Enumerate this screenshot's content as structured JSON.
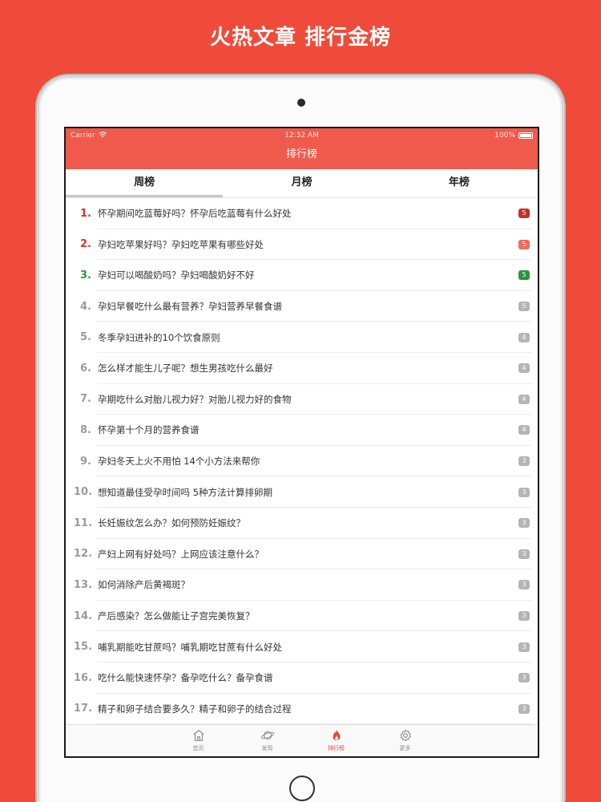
{
  "headline": "火热文章 排行金榜",
  "status": {
    "carrier": "Carrier",
    "time": "12:32 AM",
    "battery": "100%"
  },
  "nav": {
    "title": "排行榜"
  },
  "tabs": [
    {
      "label": "周榜",
      "active": true
    },
    {
      "label": "月榜",
      "active": false
    },
    {
      "label": "年榜",
      "active": false
    }
  ],
  "articles": [
    {
      "rank": "1.",
      "title": "怀孕期间吃蓝莓好吗？怀孕后吃蓝莓有什么好处",
      "count": "5"
    },
    {
      "rank": "2.",
      "title": "孕妇吃苹果好吗？孕妇吃苹果有哪些好处",
      "count": "5"
    },
    {
      "rank": "3.",
      "title": "孕妇可以喝酸奶吗？孕妇喝酸奶好不好",
      "count": "5"
    },
    {
      "rank": "4.",
      "title": "孕妇早餐吃什么最有营养？孕妇营养早餐食谱",
      "count": "5"
    },
    {
      "rank": "5.",
      "title": "冬季孕妇进补的10个饮食原则",
      "count": "4"
    },
    {
      "rank": "6.",
      "title": "怎么样才能生儿子呢？想生男孩吃什么最好",
      "count": "4"
    },
    {
      "rank": "7.",
      "title": "孕期吃什么对胎儿视力好？对胎儿视力好的食物",
      "count": "4"
    },
    {
      "rank": "8.",
      "title": "怀孕第十个月的营养食谱",
      "count": "4"
    },
    {
      "rank": "9.",
      "title": "孕妇冬天上火不用怕 14个小方法来帮你",
      "count": "3"
    },
    {
      "rank": "10.",
      "title": "想知道最佳受孕时间吗 5种方法计算排卵期",
      "count": "3"
    },
    {
      "rank": "11.",
      "title": "长妊娠纹怎么办？如何预防妊娠纹？",
      "count": "3"
    },
    {
      "rank": "12.",
      "title": "产妇上网有好处吗？上网应该注意什么？",
      "count": "3"
    },
    {
      "rank": "13.",
      "title": "如何消除产后黄褐斑？",
      "count": "3"
    },
    {
      "rank": "14.",
      "title": "产后感染？怎么做能让子宫完美恢复？",
      "count": "3"
    },
    {
      "rank": "15.",
      "title": "哺乳期能吃甘蔗吗？哺乳期吃甘蔗有什么好处",
      "count": "3"
    },
    {
      "rank": "16.",
      "title": "吃什么能快速怀孕？备孕吃什么？备孕食谱",
      "count": "3"
    },
    {
      "rank": "17.",
      "title": "精子和卵子结合要多久？精子和卵子的结合过程",
      "count": "3"
    }
  ],
  "tabbar": [
    {
      "label": "首页",
      "icon": "home-icon",
      "active": false
    },
    {
      "label": "发现",
      "icon": "planet-icon",
      "active": false
    },
    {
      "label": "排行榜",
      "icon": "flame-icon",
      "active": true
    },
    {
      "label": "更多",
      "icon": "gear-icon",
      "active": false
    }
  ],
  "colors": {
    "background": "#f04b3a",
    "navbar": "#f05a4c",
    "rank_top": "#d8322b",
    "rank_third": "#2a9640",
    "active_tab_icon": "#e5493b"
  }
}
